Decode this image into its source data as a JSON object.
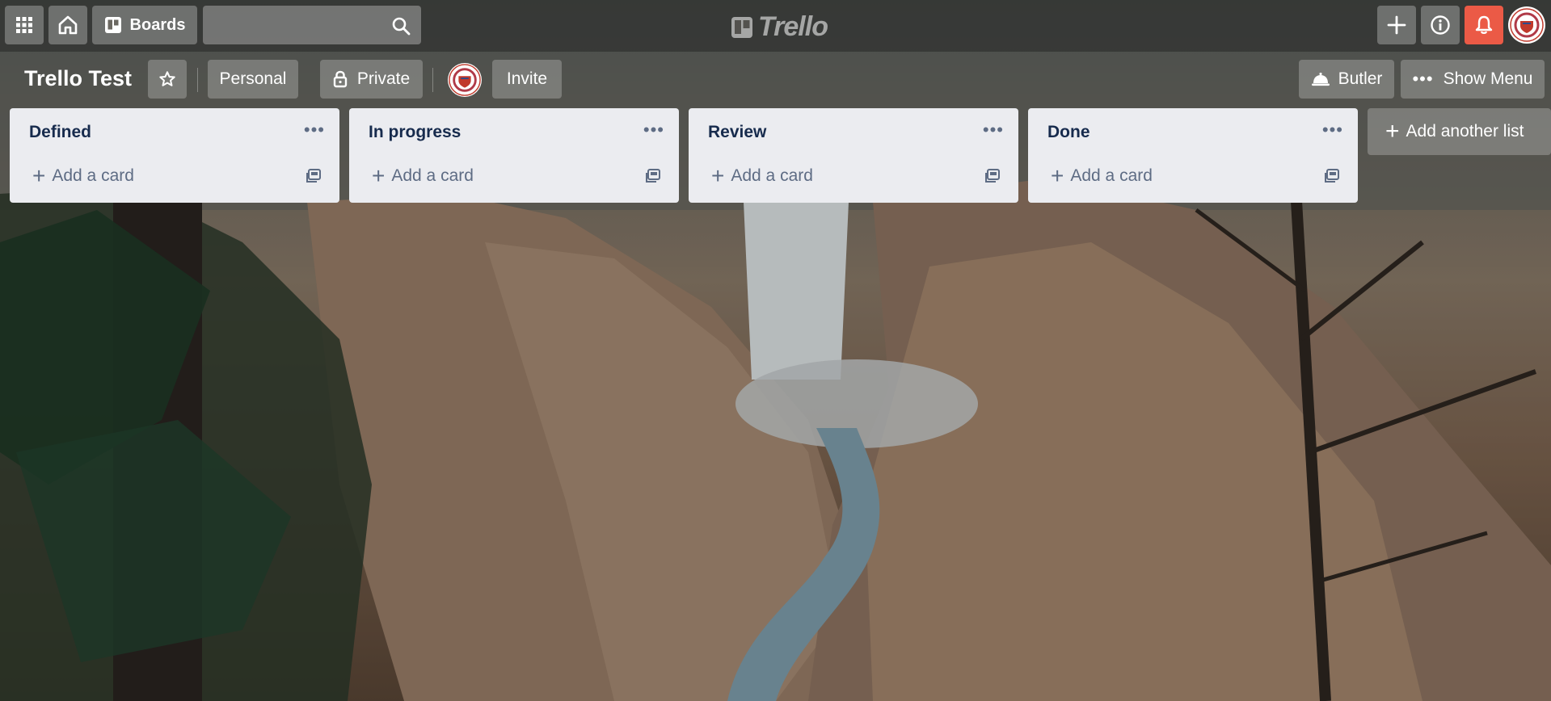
{
  "header": {
    "apps_icon": "grid-icon",
    "home_icon": "home-icon",
    "boards_label": "Boards",
    "search": {
      "value": "",
      "placeholder": ""
    },
    "logo_text": "Trello",
    "create_icon": "plus-icon",
    "info_icon": "info-icon",
    "notifications_icon": "bell-icon",
    "notifications_color": "#eb5a46"
  },
  "board": {
    "title": "Trello Test",
    "star_icon": "star-icon",
    "visibility_team": "Personal",
    "visibility": "Private",
    "invite_label": "Invite",
    "butler_label": "Butler",
    "show_menu_label": "Show Menu"
  },
  "lists": [
    {
      "title": "Defined",
      "add_card_label": "Add a card"
    },
    {
      "title": "In progress",
      "add_card_label": "Add a card"
    },
    {
      "title": "Review",
      "add_card_label": "Add a card"
    },
    {
      "title": "Done",
      "add_card_label": "Add a card"
    }
  ],
  "add_list_label": "Add another list",
  "colors": {
    "list_bg": "#ebecf0",
    "list_text": "#172b4d",
    "muted_text": "#5e6c84"
  }
}
